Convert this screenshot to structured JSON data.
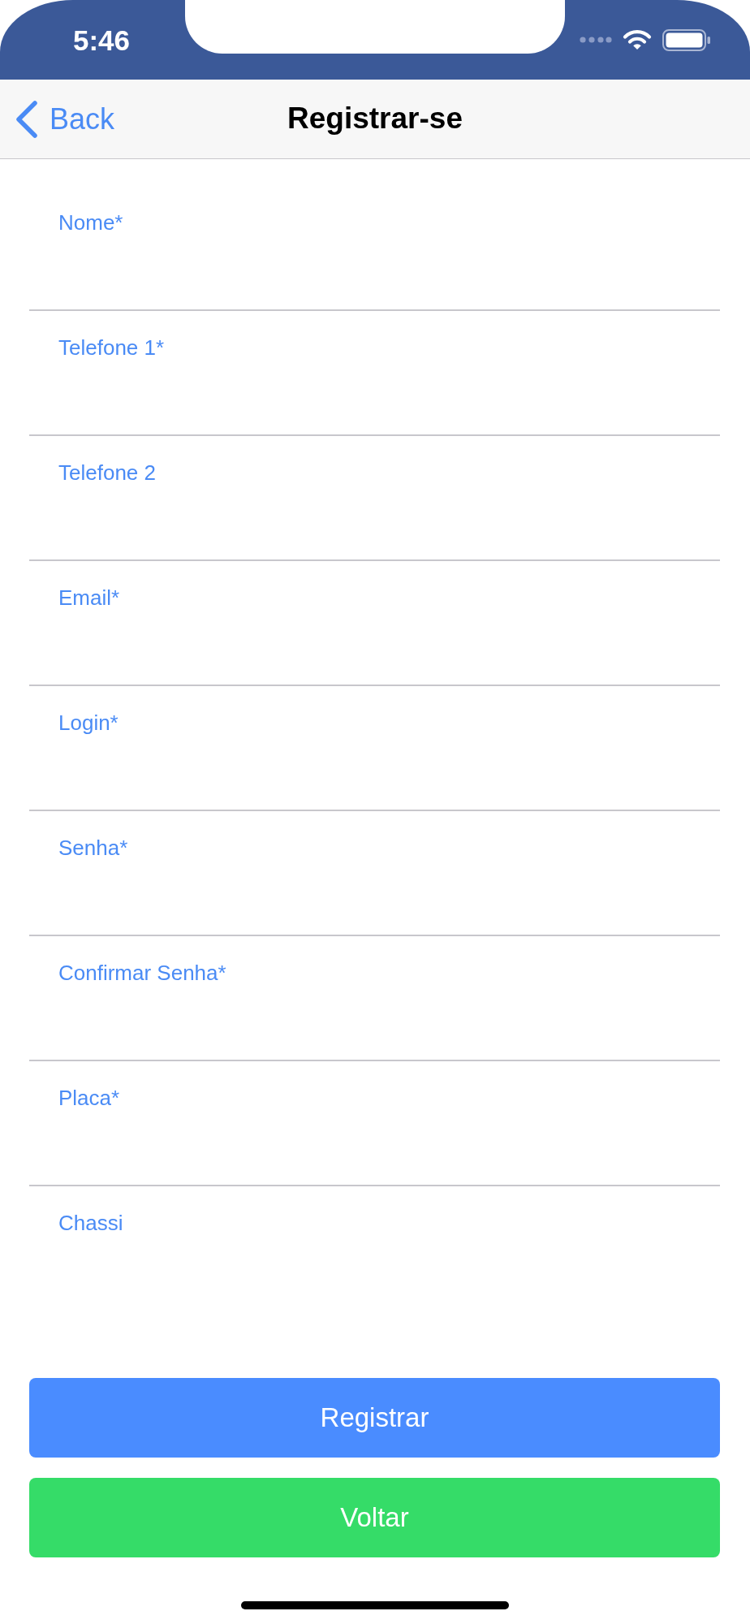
{
  "status_bar": {
    "time": "5:46"
  },
  "nav_bar": {
    "back_label": "Back",
    "title": "Registrar-se"
  },
  "fields": [
    {
      "label": "Nome*"
    },
    {
      "label": "Telefone 1*"
    },
    {
      "label": "Telefone 2"
    },
    {
      "label": "Email*"
    },
    {
      "label": "Login*"
    },
    {
      "label": "Senha*"
    },
    {
      "label": "Confirmar Senha*"
    },
    {
      "label": "Placa*"
    },
    {
      "label": "Chassi"
    }
  ],
  "buttons": [
    {
      "label": "Registrar",
      "kind": "primary"
    },
    {
      "label": "Voltar",
      "kind": "success"
    }
  ]
}
